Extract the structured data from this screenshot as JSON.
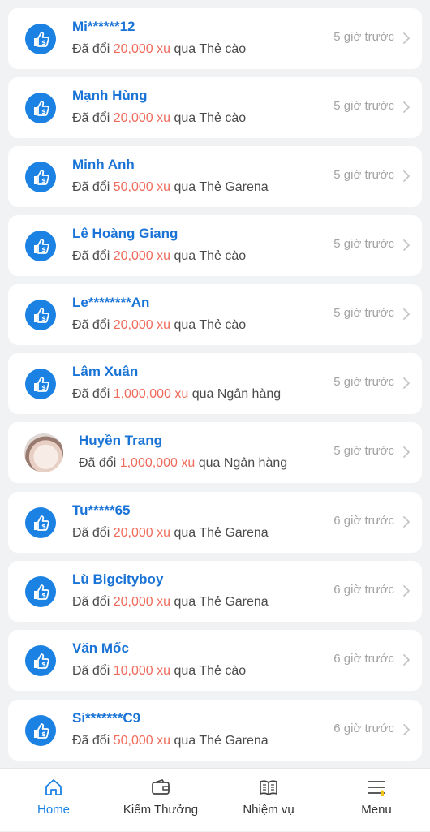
{
  "feed": {
    "verb": "Đã đổi",
    "unit": "xu",
    "via": "qua",
    "items": [
      {
        "name": "Mi******12",
        "amount": "20,000",
        "method": "Thẻ cào",
        "time": "5 giờ trước",
        "avatar": "thumbs-up-coin-icon"
      },
      {
        "name": "Mạnh Hùng",
        "amount": "20,000",
        "method": "Thẻ cào",
        "time": "5 giờ trước",
        "avatar": "thumbs-up-coin-icon"
      },
      {
        "name": "Minh Anh",
        "amount": "50,000",
        "method": "Thẻ Garena",
        "time": "5 giờ trước",
        "avatar": "thumbs-up-coin-icon"
      },
      {
        "name": "Lê Hoàng Giang",
        "amount": "20,000",
        "method": "Thẻ cào",
        "time": "5 giờ trước",
        "avatar": "thumbs-up-coin-icon"
      },
      {
        "name": "Le********An",
        "amount": "20,000",
        "method": "Thẻ cào",
        "time": "5 giờ trước",
        "avatar": "thumbs-up-coin-icon"
      },
      {
        "name": "Lâm Xuân",
        "amount": "1,000,000",
        "method": "Ngân hàng",
        "time": "5 giờ trước",
        "avatar": "thumbs-up-coin-icon"
      },
      {
        "name": "Huyền Trang",
        "amount": "1,000,000",
        "method": "Ngân hàng",
        "time": "5 giờ trước",
        "avatar": "user-photo"
      },
      {
        "name": "Tu*****65",
        "amount": "20,000",
        "method": "Thẻ Garena",
        "time": "6 giờ trước",
        "avatar": "thumbs-up-coin-icon"
      },
      {
        "name": "Lù Bigcityboy",
        "amount": "20,000",
        "method": "Thẻ Garena",
        "time": "6 giờ trước",
        "avatar": "thumbs-up-coin-icon"
      },
      {
        "name": "Văn Mốc",
        "amount": "10,000",
        "method": "Thẻ cào",
        "time": "6 giờ trước",
        "avatar": "thumbs-up-coin-icon"
      },
      {
        "name": "Si*******C9",
        "amount": "50,000",
        "method": "Thẻ Garena",
        "time": "6 giờ trước",
        "avatar": "thumbs-up-coin-icon"
      }
    ]
  },
  "tabbar": {
    "tabs": [
      {
        "label": "Home",
        "icon": "home-icon",
        "active": true
      },
      {
        "label": "Kiếm Thưởng",
        "icon": "wallet-icon",
        "active": false
      },
      {
        "label": "Nhiệm vụ",
        "icon": "book-icon",
        "active": false
      },
      {
        "label": "Menu",
        "icon": "menu-icon",
        "active": false
      }
    ]
  },
  "colors": {
    "accent": "#1b82e4",
    "name": "#1a73d6",
    "amount": "#ef6b5c",
    "time": "#a3a3a3",
    "background": "#f1f2f4",
    "badge": "#f5c518"
  }
}
